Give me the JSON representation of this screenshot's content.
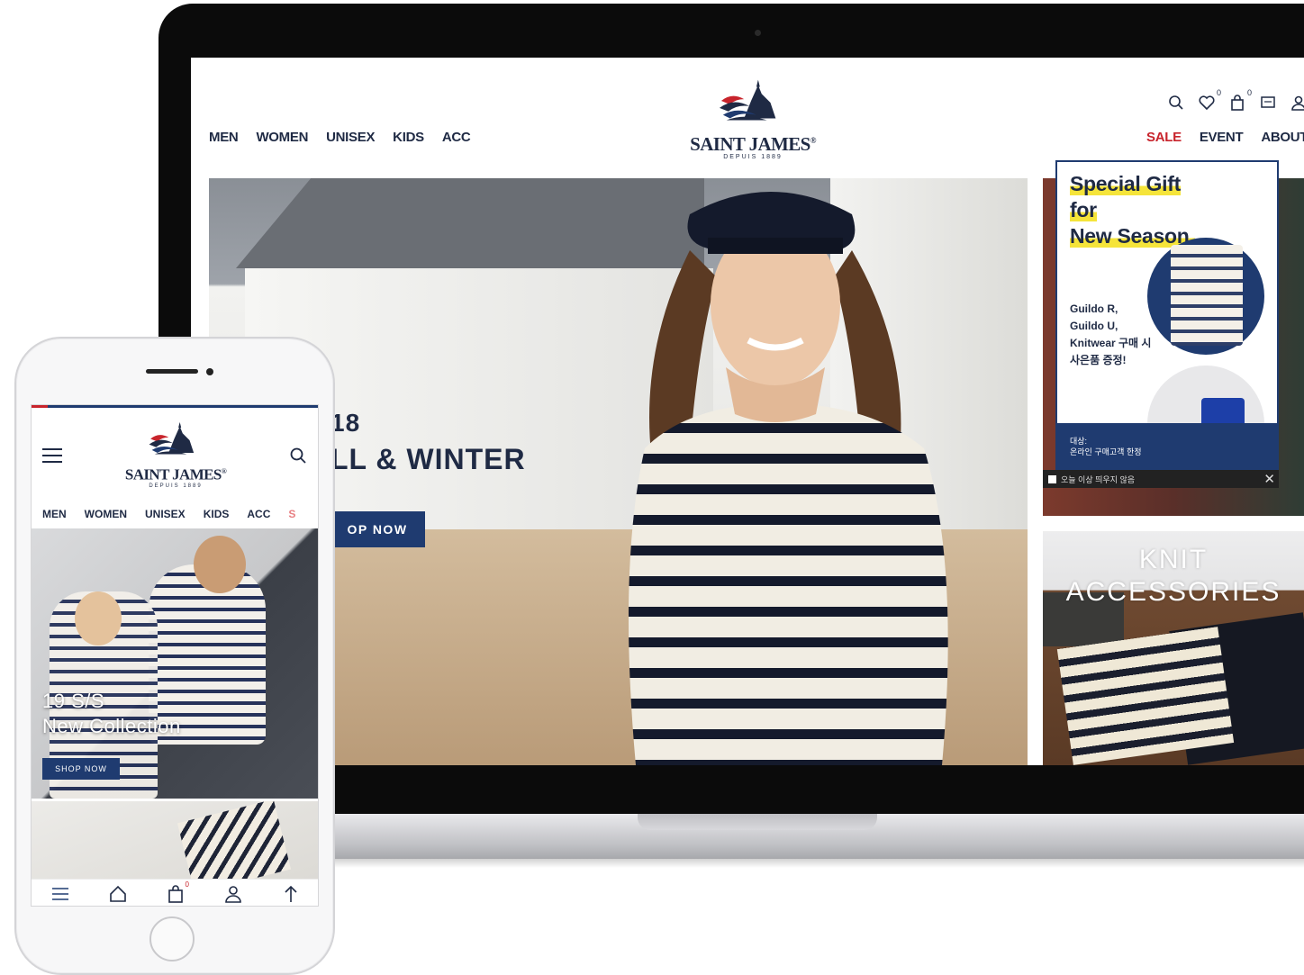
{
  "desktop": {
    "nav_left": [
      "MEN",
      "WOMEN",
      "UNISEX",
      "KIDS",
      "ACC"
    ],
    "nav_right": {
      "sale": "SALE",
      "event": "EVENT",
      "about": "ABOUT"
    },
    "logo": {
      "name": "SAINT JAMES",
      "mark": "®",
      "sub": "DEPUIS 1889"
    },
    "utility_icons": [
      "search-icon",
      "heart-icon",
      "bag-icon",
      "chat-icon",
      "user-icon"
    ],
    "badges": {
      "wishlist": "0",
      "cart": "0"
    },
    "hero": {
      "line1": "18",
      "line2": "LL & WINTER",
      "button": "OP NOW"
    },
    "popup": {
      "title_lines": [
        "Special Gift",
        "for",
        "New Season."
      ],
      "body_lines": [
        "Guildo R,",
        "Guildo U,",
        "Knitwear 구매 시",
        "사은품 증정!"
      ],
      "footer_lines": [
        "대상:",
        "온라인 구매고객 한정"
      ],
      "dismiss_label": "오늘 이상 띄우지 않음",
      "close_glyph": "✕"
    },
    "promo": {
      "title_lines": [
        "KNIT",
        "ACCESSORIES"
      ]
    }
  },
  "mobile": {
    "logo": {
      "name": "SAINT JAMES",
      "mark": "®",
      "sub": "DEPUIS 1889"
    },
    "nav": [
      "MEN",
      "WOMEN",
      "UNISEX",
      "KIDS",
      "ACC",
      "S"
    ],
    "hero": {
      "line1": "19 S/S",
      "line2": "New Collection",
      "button": "SHOP NOW"
    },
    "tabbar_icons": [
      "menu-icon",
      "home-icon",
      "bag-icon",
      "user-icon",
      "arrow-up-icon"
    ],
    "cart_badge": "0"
  },
  "colors": {
    "navy": "#1f2a44",
    "accent_blue": "#1f3b70",
    "sale_red": "#c8242c",
    "highlight": "#f5e43a"
  }
}
